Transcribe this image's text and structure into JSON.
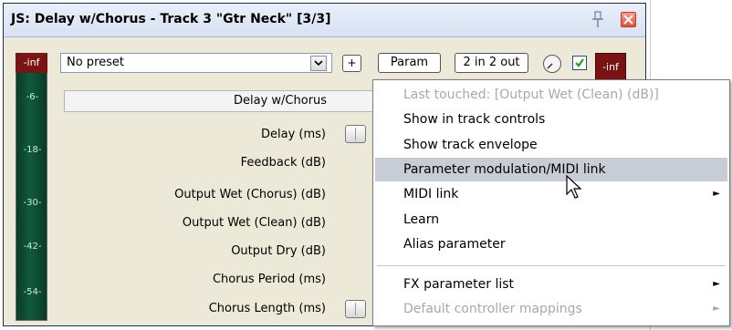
{
  "window": {
    "title": "JS: Delay w/Chorus - Track 3 \"Gtr Neck\" [3/3]"
  },
  "toolbar": {
    "preset_value": "No preset",
    "plus_label": "+",
    "param_label": "Param",
    "io_label": "2 in 2 out",
    "vu_left_top": "-inf",
    "vu_right_top": "-inf"
  },
  "vu_ticks": [
    "-6-",
    "-18-",
    "-30-",
    "-42-",
    "-54-"
  ],
  "plugin": {
    "name": "Delay w/Chorus",
    "params": [
      "Delay (ms)",
      "Feedback (dB)",
      "Output Wet (Chorus) (dB)",
      "Output Wet (Clean) (dB)",
      "Output Dry (dB)",
      "Chorus Period (ms)",
      "Chorus Length (ms)"
    ]
  },
  "context_menu": {
    "items": [
      {
        "label": "Last touched: [Output Wet (Clean) (dB)]",
        "disabled": true
      },
      {
        "label": "Show in track controls"
      },
      {
        "label": "Show track envelope"
      },
      {
        "label": "Parameter modulation/MIDI link",
        "highlighted": true
      },
      {
        "label": "MIDI link",
        "submenu": true
      },
      {
        "label": "Learn"
      },
      {
        "label": "Alias parameter"
      },
      {
        "label": "FX parameter list",
        "submenu": true
      },
      {
        "label": "Default controller mappings",
        "disabled": true,
        "submenu": true
      }
    ],
    "submenu_arrow": "►"
  },
  "colors": {
    "menu_highlight": "#c8ccd4",
    "vu_clip": "#7a1414",
    "vu_meter": "#0f5a3d"
  }
}
